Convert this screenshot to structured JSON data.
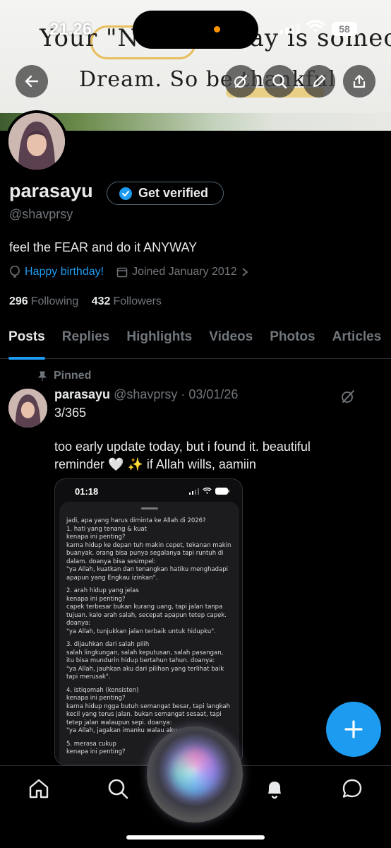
{
  "status_bar": {
    "time": "21.26",
    "battery": "58"
  },
  "banner": {
    "line1": "Your \"Normal\" day is someone's",
    "line2": "Dream. So be thankful"
  },
  "profile": {
    "name": "parasayu",
    "verify_label": "Get verified",
    "handle": "@shavprsy",
    "bio": "feel the FEAR and do it ANYWAY",
    "birthday": "Happy birthday!",
    "joined": "Joined January 2012",
    "following_count": "296",
    "following_label": "Following",
    "followers_count": "432",
    "followers_label": "Followers"
  },
  "tabs": [
    "Posts",
    "Replies",
    "Highlights",
    "Videos",
    "Photos",
    "Articles"
  ],
  "post": {
    "pinned_label": "Pinned",
    "name": "parasayu",
    "handle_date": "@shavprsy · 03/01/26",
    "line1": "3/365",
    "text": "too early update today, but i found it. beautiful reminder 🤍 ✨ if Allah wills, aamiin"
  },
  "embedded": {
    "time": "01:18",
    "lines": [
      "jadi, apa yang harus diminta ke Allah di 2026?",
      "1. hati yang tenang & kuat",
      "kenapa ini penting?",
      "karna hidup ke depan tuh makin cepet, tekanan makin buanyak. orang bisa punya segalanya tapi runtuh di dalam. doanya bisa sesimpel:",
      "\"ya Allah, kuatkan dan tenangkan hatiku menghadapi apapun yang Engkau izinkan\".",
      "",
      "2. arah hidup yang jelas",
      "kenapa ini penting?",
      "capek terbesar bukan kurang uang, tapi jalan tanpa tujuan. kalo arah salah, secepat apapun tetep capek. doanya:",
      "\"ya Allah, tunjukkan jalan terbaik untuk hidupku\".",
      "",
      "3. dijauhkan dari salah pilih",
      "salah lingkungan, salah keputusan, salah pasangan, itu bisa mundurin hidup bertahun tahun. doanya:",
      "\"ya Allah, jauhkan aku dari pilihan yang terlihat baik tapi merusak\".",
      "",
      "4. istiqomah (konsisten)",
      "kenapa ini penting?",
      "karna hidup ngga butuh semangat besar, tapi langkah kecil yang terus jalan. bukan semangat sesaat, tapi tetep jalan walaupun sepi. doanya:",
      "\"ya Allah, jagakan imanku walau aku s",
      "",
      "5. merasa cukup",
      "kenapa ini penting?"
    ]
  }
}
